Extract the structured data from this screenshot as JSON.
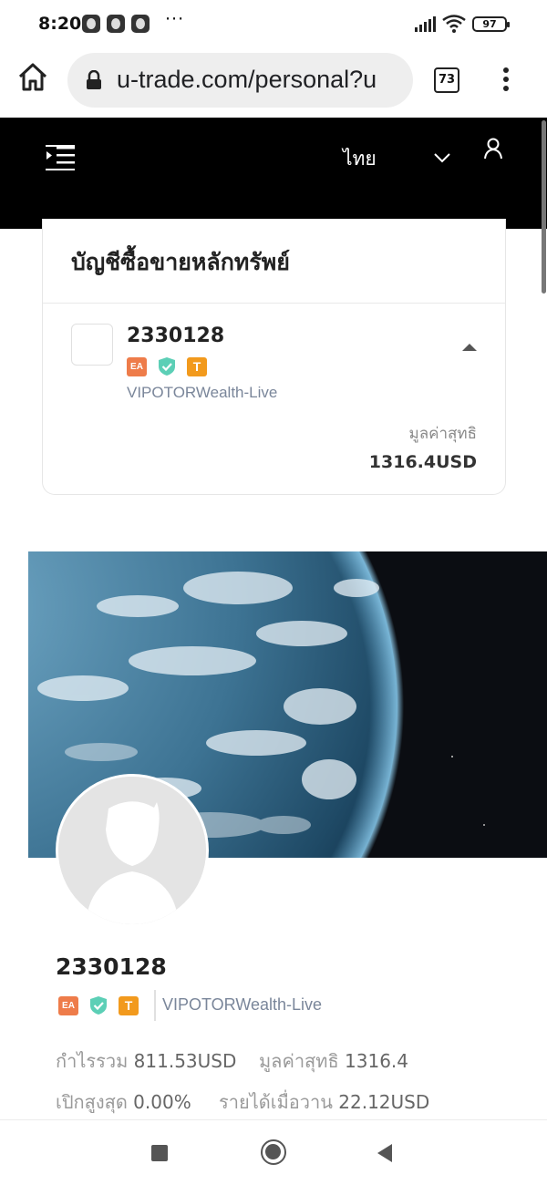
{
  "status_bar": {
    "time": "8:20",
    "dots": "···",
    "battery": "97",
    "icons": [
      "notification-icon",
      "notification-icon",
      "notification-icon",
      "signal-icon",
      "wifi-icon",
      "battery-icon"
    ]
  },
  "browser": {
    "url": "u-trade.com/personal?u",
    "tab_count": "73",
    "icons": [
      "home-icon",
      "lock-icon",
      "tabs-icon",
      "menu-icon"
    ]
  },
  "site_header": {
    "language": "ไทย",
    "icons": [
      "nav-toggle-icon",
      "chevron-down-icon",
      "user-icon"
    ],
    "background": "#000000"
  },
  "account_card": {
    "title": "บัญชีซื้อขายหลักทรัพย์",
    "account_number": "2330128",
    "badges": [
      "EA",
      "shield-check",
      "T"
    ],
    "server": "VIPOTORWealth-Live",
    "equity_label": "มูลค่าสุทธิ",
    "equity_value": "1316.4USD"
  },
  "profile": {
    "account_number": "2330128",
    "badges": [
      "EA",
      "shield-check",
      "T"
    ],
    "server": "VIPOTORWealth-Live",
    "stats": {
      "total_profit_label": "กำไรรวม",
      "total_profit_value": "811.53USD",
      "equity_label": "มูลค่าสุทธิ",
      "equity_value": "1316.4",
      "max_open_label": "เปิกสูงสุด",
      "max_open_value": "0.00%",
      "yesterday_income_label": "รายได้เมื่อวาน",
      "yesterday_income_value": "22.12USD"
    }
  },
  "colors": {
    "badge_ea": "#ee7c4a",
    "badge_shield": "#5ccfb6",
    "badge_t": "#f29a1d",
    "muted_text": "#7a869a"
  },
  "nav_bar": {
    "icons": [
      "recent-apps-icon",
      "home-button-icon",
      "back-icon"
    ]
  }
}
